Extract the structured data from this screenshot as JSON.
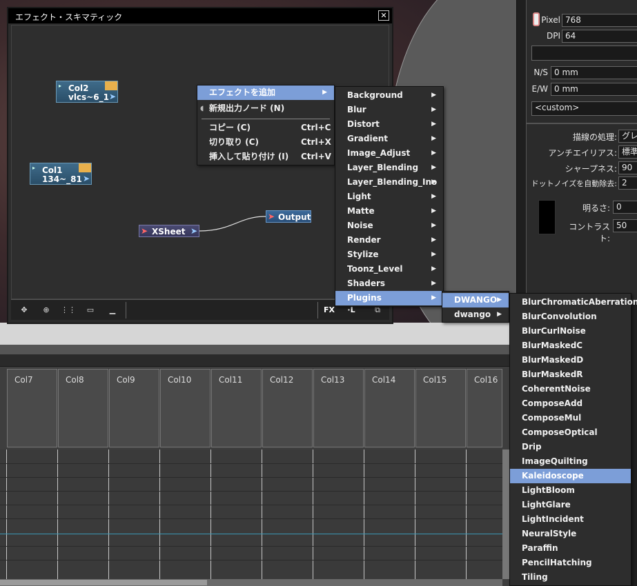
{
  "schematic": {
    "title": "エフェクト・スキマティック",
    "close_icon": "✕",
    "nodes": {
      "col2": {
        "name": "Col2",
        "sub": "vlcs~6_1"
      },
      "col1": {
        "name": "Col1",
        "sub": "134~_81"
      },
      "xsheet": {
        "name": "XSheet"
      },
      "output": {
        "name": "Output"
      }
    },
    "toolbar_right": {
      "fx": "FX",
      "l": "·L"
    }
  },
  "context_menu": {
    "add_effect": "エフェクトを追加",
    "new_output": "新規出力ノード (N)",
    "copy": "コピー (C)",
    "copy_sc": "Ctrl+C",
    "cut": "切り取り (C)",
    "cut_sc": "Ctrl+X",
    "paste_insert": "挿入して貼り付け (I)",
    "paste_sc": "Ctrl+V"
  },
  "effect_menu": [
    "Background",
    "Blur",
    "Distort",
    "Gradient",
    "Image_Adjust",
    "Layer_Blending",
    "Layer_Blending_Ino",
    "Light",
    "Matte",
    "Noise",
    "Render",
    "Stylize",
    "Toonz_Level",
    "Shaders",
    "Plugins"
  ],
  "plugins_menu": [
    "DWANGO",
    "dwango"
  ],
  "dwango_menu": [
    "BlurChromaticAberration",
    "BlurConvolution",
    "BlurCurlNoise",
    "BlurMaskedC",
    "BlurMaskedD",
    "BlurMaskedR",
    "CoherentNoise",
    "ComposeAdd",
    "ComposeMul",
    "ComposeOptical",
    "Drip",
    "ImageQuilting",
    "Kaleidoscope",
    "LightBloom",
    "LightGlare",
    "LightIncident",
    "NeuralStyle",
    "Paraffin",
    "PencilHatching",
    "Tiling"
  ],
  "selected": {
    "effect": "Plugins",
    "plugins": "DWANGO",
    "dwango": "Kaleidoscope"
  },
  "xsheet": {
    "columns": [
      "Col7",
      "Col8",
      "Col9",
      "Col10",
      "Col11",
      "Col12",
      "Col13",
      "Col14",
      "Col15",
      "Col16"
    ]
  },
  "right_panel": {
    "pixel_label": "Pixel",
    "pixel_value": "768",
    "dpi_label": "DPI",
    "dpi_value": "64",
    "ns_label": "N/S",
    "ns_value": "0 mm",
    "ew_label": "E/W",
    "ew_value": "0 mm",
    "preset_value": "<custom>",
    "line_process_label": "描線の処理:",
    "line_process_value": "グレ",
    "antialias_label": "アンチエイリアス:",
    "antialias_value": "標準",
    "sharpness_label": "シャープネス:",
    "sharpness_value": "90",
    "dot_noise_label": "ドットノイズを自動除去:",
    "dot_noise_value": "2",
    "brightness_label": "明るさ:",
    "brightness_value": "0",
    "contrast_label": "コントラスト:",
    "contrast_value": "50"
  }
}
